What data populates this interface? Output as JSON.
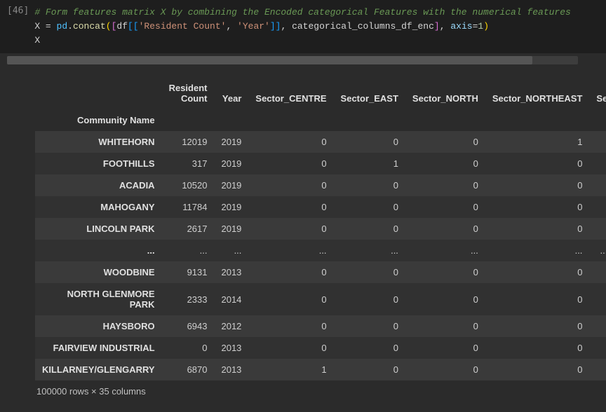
{
  "cell": {
    "prompt": "[46]",
    "code_comment": "# Form features matrix X by combining the Encoded categorical Features with the numerical features",
    "line2": {
      "X": "X",
      "eq": " = ",
      "pd": "pd",
      "dot": ".",
      "concat": "concat",
      "lpar": "(",
      "lbrk": "[",
      "df": "df",
      "lb2": "[[",
      "s1": "'Resident Count'",
      "comma1": ", ",
      "s2": "'Year'",
      "rb2": "]]",
      "comma2": ", ",
      "cat": "categorical_columns_df_enc",
      "rbrk": "]",
      "comma3": ", ",
      "axis_kw": "axis",
      "eq2": "=",
      "one": "1",
      "rpar": ")"
    },
    "line3": "X"
  },
  "chart_data": {
    "type": "table",
    "index_name": "Community Name",
    "columns": [
      "Resident Count",
      "Year",
      "Sector_CENTRE",
      "Sector_EAST",
      "Sector_NORTH",
      "Sector_NORTHEAST",
      "Se"
    ],
    "rows": [
      {
        "name": "WHITEHORN",
        "vals": [
          "12019",
          "2019",
          "0",
          "0",
          "0",
          "1",
          ""
        ]
      },
      {
        "name": "FOOTHILLS",
        "vals": [
          "317",
          "2019",
          "0",
          "1",
          "0",
          "0",
          ""
        ]
      },
      {
        "name": "ACADIA",
        "vals": [
          "10520",
          "2019",
          "0",
          "0",
          "0",
          "0",
          ""
        ]
      },
      {
        "name": "MAHOGANY",
        "vals": [
          "11784",
          "2019",
          "0",
          "0",
          "0",
          "0",
          ""
        ]
      },
      {
        "name": "LINCOLN PARK",
        "vals": [
          "2617",
          "2019",
          "0",
          "0",
          "0",
          "0",
          ""
        ]
      },
      {
        "name": "...",
        "vals": [
          "...",
          "...",
          "...",
          "...",
          "...",
          "...",
          "..."
        ]
      },
      {
        "name": "WOODBINE",
        "vals": [
          "9131",
          "2013",
          "0",
          "0",
          "0",
          "0",
          ""
        ]
      },
      {
        "name": "NORTH GLENMORE PARK",
        "vals": [
          "2333",
          "2014",
          "0",
          "0",
          "0",
          "0",
          ""
        ]
      },
      {
        "name": "HAYSBORO",
        "vals": [
          "6943",
          "2012",
          "0",
          "0",
          "0",
          "0",
          ""
        ]
      },
      {
        "name": "FAIRVIEW INDUSTRIAL",
        "vals": [
          "0",
          "2013",
          "0",
          "0",
          "0",
          "0",
          ""
        ]
      },
      {
        "name": "KILLARNEY/GLENGARRY",
        "vals": [
          "6870",
          "2013",
          "1",
          "0",
          "0",
          "0",
          ""
        ]
      }
    ],
    "footer": "100000 rows × 35 columns"
  }
}
